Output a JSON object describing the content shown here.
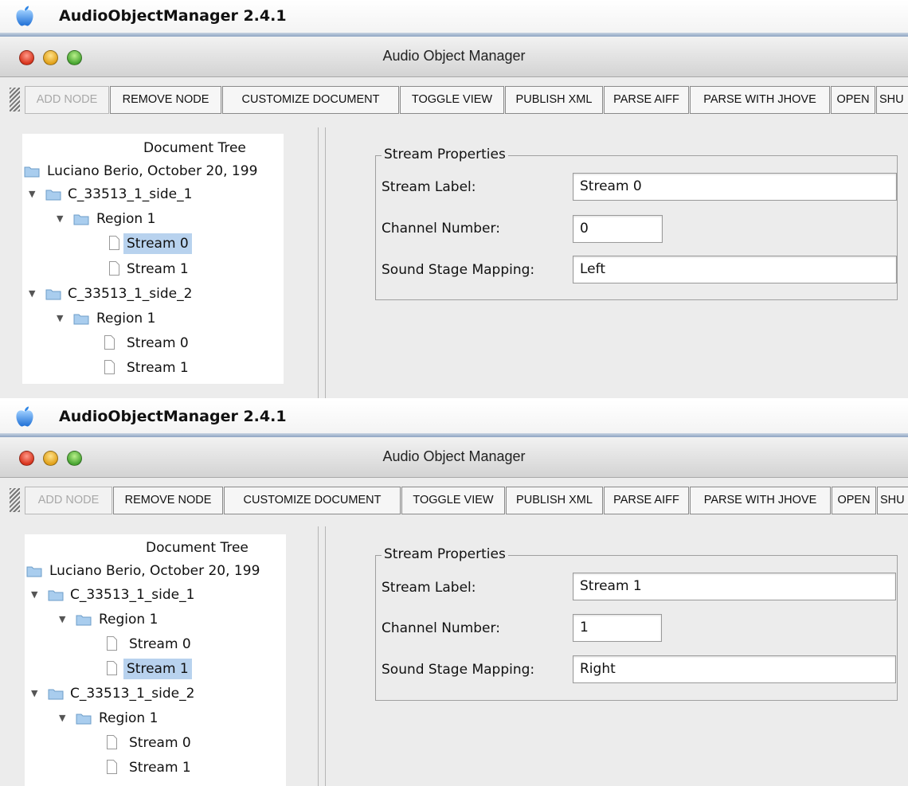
{
  "windows": [
    {
      "app_name": "AudioObjectManager 2.4.1",
      "window_title": "Audio Object Manager",
      "toolbar": [
        "ADD NODE",
        "REMOVE NODE",
        "CUSTOMIZE DOCUMENT",
        "TOGGLE VIEW",
        "PUBLISH XML",
        "PARSE AIFF",
        "PARSE WITH JHOVE",
        "OPEN",
        "SHU"
      ],
      "toolbar_disabled": [
        "ADD NODE"
      ],
      "tree": {
        "heading": "Document Tree",
        "root": "Luciano Berio, October 20, 199",
        "nodes": [
          "C_33513_1_side_1",
          "Region 1",
          "Stream 0",
          "Stream 1",
          "C_33513_1_side_2",
          "Region 1",
          "Stream 0",
          "Stream 1"
        ],
        "selected": "Stream 0"
      },
      "properties": {
        "legend": "Stream Properties",
        "stream_label_label": "Stream Label:",
        "stream_label_value": "Stream 0",
        "channel_number_label": "Channel Number:",
        "channel_number_value": "0",
        "sound_stage_mapping_label": "Sound Stage Mapping:",
        "sound_stage_mapping_value": "Left"
      }
    },
    {
      "app_name": "AudioObjectManager 2.4.1",
      "window_title": "Audio Object Manager",
      "toolbar": [
        "ADD NODE",
        "REMOVE NODE",
        "CUSTOMIZE DOCUMENT",
        "TOGGLE VIEW",
        "PUBLISH XML",
        "PARSE AIFF",
        "PARSE WITH JHOVE",
        "OPEN",
        "SHU"
      ],
      "toolbar_disabled": [
        "ADD NODE"
      ],
      "tree": {
        "heading": "Document Tree",
        "root": "Luciano Berio, October 20, 199",
        "nodes": [
          "C_33513_1_side_1",
          "Region 1",
          "Stream 0",
          "Stream 1",
          "C_33513_1_side_2",
          "Region 1",
          "Stream 0",
          "Stream 1"
        ],
        "selected": "Stream 1"
      },
      "properties": {
        "legend": "Stream Properties",
        "stream_label_label": "Stream Label:",
        "stream_label_value": "Stream 1",
        "channel_number_label": "Channel Number:",
        "channel_number_value": "1",
        "sound_stage_mapping_label": "Sound Stage Mapping:",
        "sound_stage_mapping_value": "Right"
      }
    }
  ],
  "colors": {
    "selection": "#b8d2ee",
    "window_bg": "#ececec",
    "close": "#d8341d",
    "minimize": "#e1a11a",
    "zoom": "#48a532"
  },
  "icons": [
    "apple-logo-icon",
    "folder-icon",
    "document-icon",
    "disclosure-triangle-icon",
    "toolbar-grip-icon"
  ]
}
